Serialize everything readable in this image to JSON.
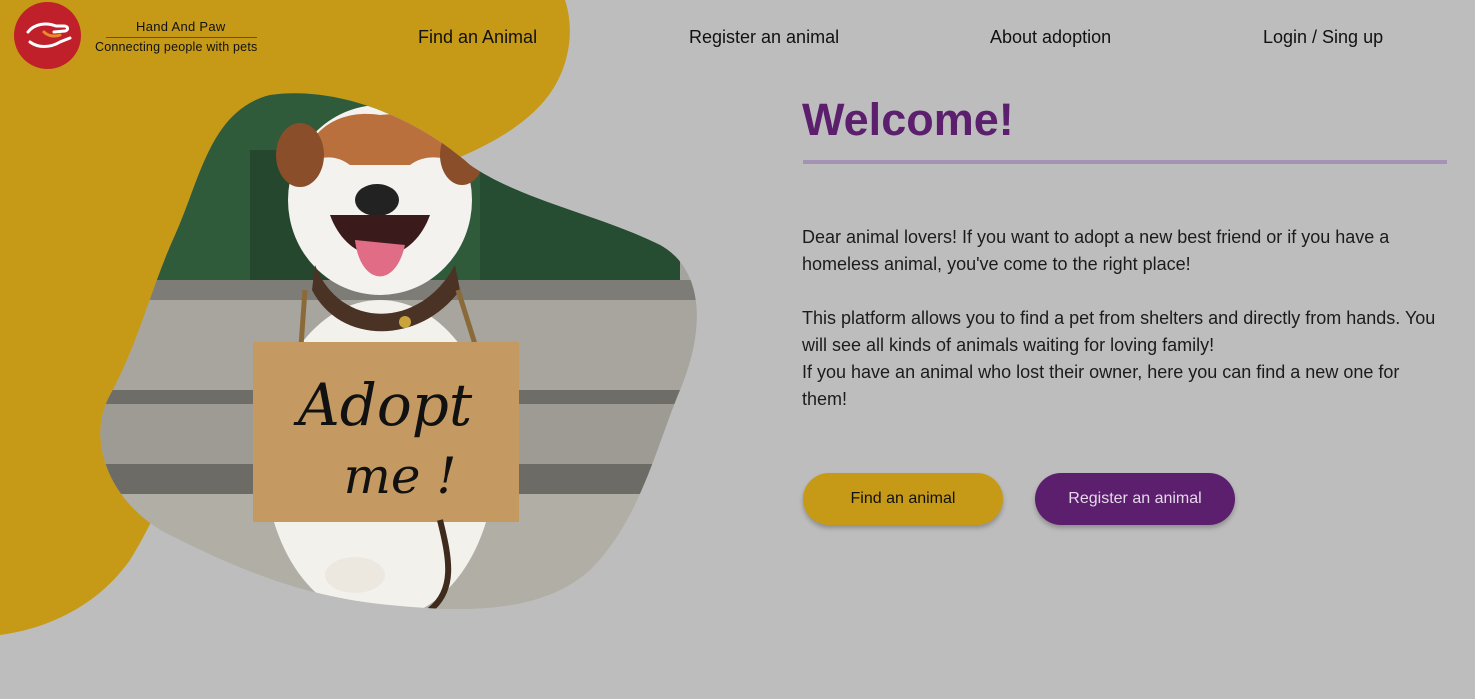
{
  "brand": {
    "name": "Hand And Paw",
    "tagline": "Connecting people with pets",
    "logo_icon": "hand-paw-icon",
    "logo_color": "#c0202a"
  },
  "nav": {
    "items": [
      {
        "label": "Find an Animal"
      },
      {
        "label": "Register an animal"
      },
      {
        "label": "About adoption"
      },
      {
        "label": "Login / Sing up"
      }
    ]
  },
  "hero": {
    "title": "Welcome!",
    "paragraph1": "Dear animal lovers! If you want to adopt a new best friend or if you have a homeless animal, you've come to the right place!",
    "paragraph2": "This platform allows you to find a pet from shelters and directly from hands. You will see all kinds of animals waiting for loving family!",
    "paragraph3": "If you have an animal who lost their owner, here you can find a new one for them!",
    "image_sign_text": "Adopt me!"
  },
  "buttons": {
    "find_label": "Find an animal",
    "register_label": "Register an animal"
  },
  "colors": {
    "background": "#bdbdbd",
    "accent_gold": "#c69a17",
    "accent_purple": "#5b1f6e"
  }
}
